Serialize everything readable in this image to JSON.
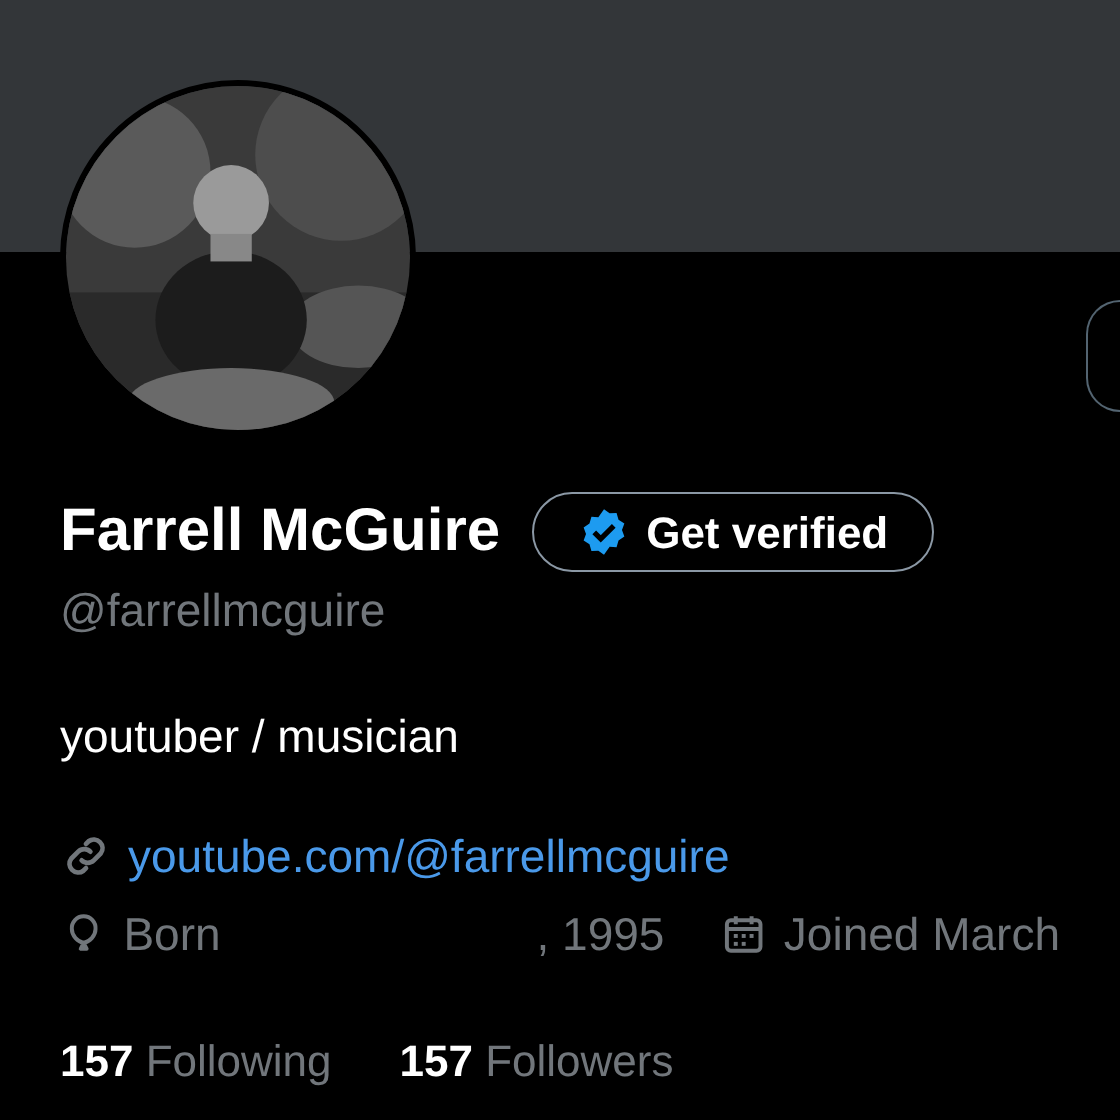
{
  "profile": {
    "name": "Farrell McGuire",
    "verify_button": "Get verified",
    "handle": "@farrellmcguire",
    "bio": "youtuber / musician",
    "link": "youtube.com/@farrellmcguire",
    "born_label": "Born",
    "born_year": ", 1995",
    "joined": "Joined March",
    "stats": [
      {
        "count": "157",
        "label": "Following"
      },
      {
        "count": "157",
        "label": "Followers"
      }
    ]
  }
}
